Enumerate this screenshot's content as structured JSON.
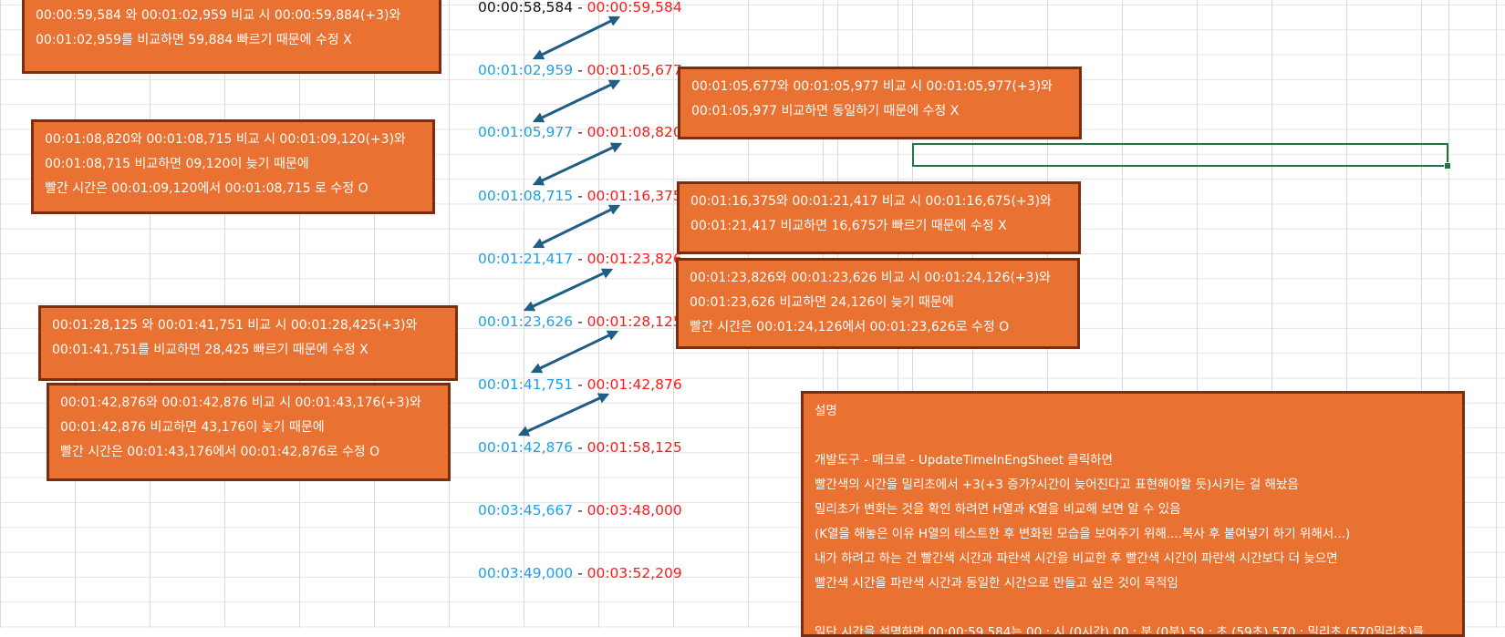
{
  "timestamp_rows": [
    {
      "left": "00:00:58,584",
      "left_color": "black",
      "sep": "-",
      "right": "00:00:59,584"
    },
    {
      "left": "00:01:02,959",
      "left_color": "blue",
      "sep": "-",
      "right": "00:01:05,677"
    },
    {
      "left": "00:01:05,977",
      "left_color": "blue",
      "sep": "-",
      "right": "00:01:08,820"
    },
    {
      "left": "00:01:08,715",
      "left_color": "blue",
      "sep": "-",
      "right": "00:01:16,375"
    },
    {
      "left": "00:01:21,417",
      "left_color": "blue",
      "sep": "-",
      "right": "00:01:23,826"
    },
    {
      "left": "00:01:23,626",
      "left_color": "blue",
      "sep": "-",
      "right": "00:01:28,125"
    },
    {
      "left": "00:01:41,751",
      "left_color": "blue",
      "sep": "-",
      "right": "00:01:42,876"
    },
    {
      "left": "00:01:42,876",
      "left_color": "blue",
      "sep": "-",
      "right": "00:01:58,125"
    },
    {
      "left": "00:03:45,667",
      "left_color": "blue",
      "sep": "-",
      "right": "00:03:48,000"
    },
    {
      "left": "00:03:49,000",
      "left_color": "blue",
      "sep": "-",
      "right": "00:03:52,209"
    }
  ],
  "notes": {
    "note1": [
      "00:00:59,584 와  00:01:02,959 비교 시 00:00:59,884(+3)와",
      " 00:01:02,959를 비교하면 59,884 빠르기 때문에 수정 X"
    ],
    "note2": [
      "00:01:05,677와  00:01:05,977 비교 시 00:01:05,977(+3)와",
      "00:01:05,977 비교하면  동일하기 때문에 수정 X"
    ],
    "note3": [
      "00:01:08,820와  00:01:08,715 비교 시 00:01:09,120(+3)와",
      "00:01:08,715 비교하면 09,120이 늦기 때문에",
      "빨간 시간은 00:01:09,120에서 00:01:08,715 로 수정  O"
    ],
    "note4": [
      "00:01:16,375와  00:01:21,417 비교 시 00:01:16,675(+3)와",
      "00:01:21,417 비교하면 16,675가 빠르기 때문에 수정 X"
    ],
    "note5": [
      "00:01:23,826와  00:01:23,626 비교 시 00:01:24,126(+3)와",
      "00:01:23,626 비교하면 24,126이 늦기 때문에",
      "빨간 시간은 00:01:24,126에서 00:01:23,626로 수정 O"
    ],
    "note6": [
      "00:01:28,125 와  00:01:41,751 비교 시 00:01:28,425(+3)와",
      " 00:01:41,751를 비교하면 28,425 빠르기 때문에 수정 X"
    ],
    "note7": [
      "00:01:42,876와  00:01:42,876 비교 시 00:01:43,176(+3)와",
      "00:01:42,876 비교하면 43,176이 늦기 때문에",
      "빨간 시간은 00:01:43,176에서 00:01:42,876로 수정  O"
    ],
    "description": [
      "설명",
      "",
      "개발도구 - 매크로 - UpdateTimeInEngSheet 클릭하면",
      "빨간색의 시간을 밀리초에서 +3(+3 증가?시간이 늦어진다고 표현해야할 듯)시키는 걸 해놨음",
      "밀리초가 변화는 것을 확인 하려면 H열과 K열을 비교해 보면 알 수 있음",
      "(K열을 해놓은 이유 H열의 테스트한 후 변화된 모습을 보여주기 위해....복사 후 붙여넣기 하기 위해서...)",
      "내가 하려고 하는 건 빨간색 시간과 파란색 시간을 비교한 후 빨간색 시간이 파란색 시간보다 더 늦으면",
      "빨간색 시간을 파란색 시간과 동일한 시간으로 만들고 싶은 것이 목적임",
      "",
      "일단 시간을 설명하면 00:00:59,584는 00 : 시 (0시간) 00 : 분 (0분) 59 : 초 (59초) 570 : 밀리초 (570밀리초)를"
    ]
  },
  "colors": {
    "box_fill": "#e97132",
    "box_border": "#7a2e10",
    "arrow": "#1f5f85",
    "blue_text": "#1ea0e6",
    "red_text": "#ff1a1a",
    "selection": "#217346"
  }
}
